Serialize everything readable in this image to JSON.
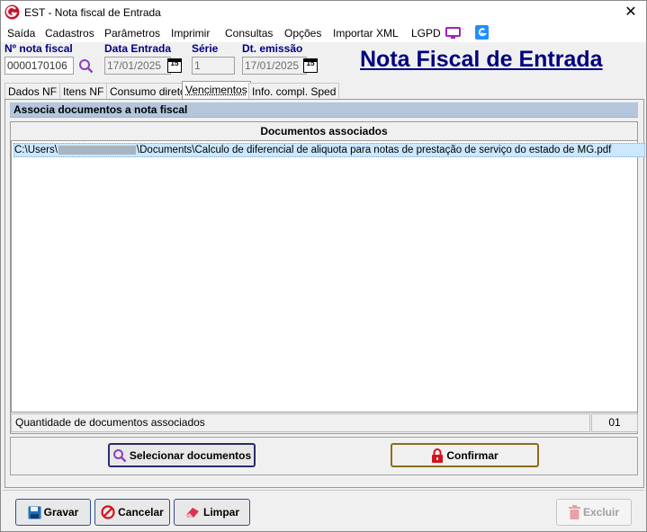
{
  "window": {
    "title": "EST - Nota fiscal de Entrada"
  },
  "menu": [
    "Saída",
    "Cadastros",
    "Parâmetros",
    "Imprimir",
    "Consultas",
    "Opções",
    "Importar XML",
    "LGPD"
  ],
  "header": {
    "nota_label": "Nº nota fiscal",
    "nota_value": "0000170106",
    "entrada_label": "Data Entrada",
    "entrada_value": "17/01/2025",
    "serie_label": "Série",
    "serie_value": "1",
    "emissao_label": "Dt. emissão",
    "emissao_value": "17/01/2025",
    "calendar_glyph": "15",
    "big_title": "Nota Fiscal de Entrada"
  },
  "tabs": [
    {
      "label": "Dados NF",
      "active": false
    },
    {
      "label": "Itens NF",
      "active": false
    },
    {
      "label": "Consumo direto",
      "active": false
    },
    {
      "label": "Vencimentos",
      "active": true
    },
    {
      "label": "Info. compl. Sped",
      "active": false
    }
  ],
  "section": {
    "title": "Associa documentos a nota fiscal",
    "grid_header": "Documentos associados",
    "row_prefix": "C:\\Users\\",
    "row_suffix": "\\Documents\\Calculo de diferencial de aliquota para notas de prestação de serviço do estado de MG.pdf",
    "qty_label": "Quantidade de documentos associados",
    "qty_value": "01",
    "select_button": "Selecionar documentos",
    "confirm_button": "Confirmar"
  },
  "footer": {
    "save": "Gravar",
    "cancel": "Cancelar",
    "clear": "Limpar",
    "delete": "Excluir"
  },
  "colors": {
    "accent": "#000080",
    "section": "#b3c6dc",
    "selection": "#cce8ff"
  }
}
